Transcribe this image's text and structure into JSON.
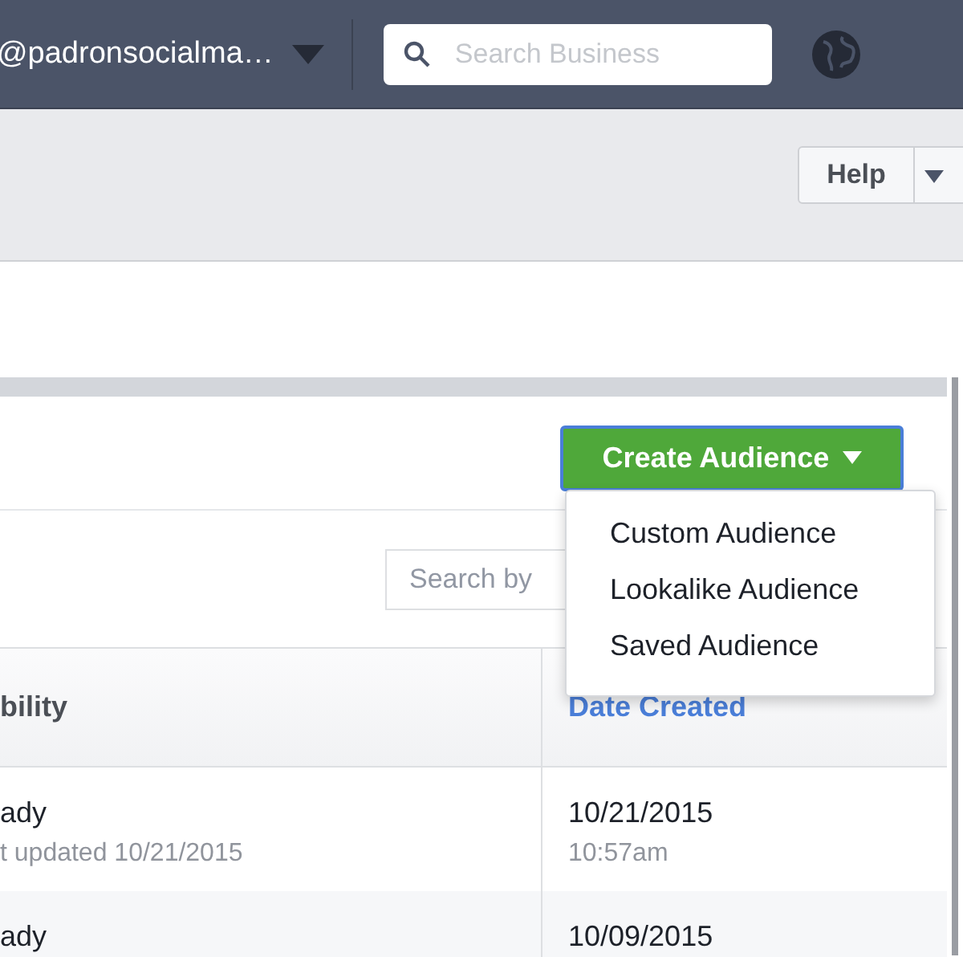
{
  "top_bar": {
    "account": "@padronsocialma…",
    "search": {
      "placeholder": "Search Business"
    }
  },
  "sub_header": {
    "help_button": "Help"
  },
  "panel": {
    "create_button": "Create Audience",
    "search": {
      "placeholder": "Search by"
    },
    "menu": [
      {
        "label": "Custom Audience"
      },
      {
        "label": "Lookalike Audience"
      },
      {
        "label": "Saved Audience"
      }
    ]
  },
  "table": {
    "columns": [
      {
        "label": "bility",
        "sorted": false
      },
      {
        "label": "Date Created",
        "sorted": true
      }
    ],
    "rows": [
      {
        "cells": [
          {
            "main": "ady",
            "sub": "t updated 10/21/2015"
          },
          {
            "main": "10/21/2015",
            "sub": "10:57am"
          }
        ]
      },
      {
        "cells": [
          {
            "main": "ady"
          },
          {
            "main": "10/09/2015"
          }
        ]
      }
    ]
  }
}
